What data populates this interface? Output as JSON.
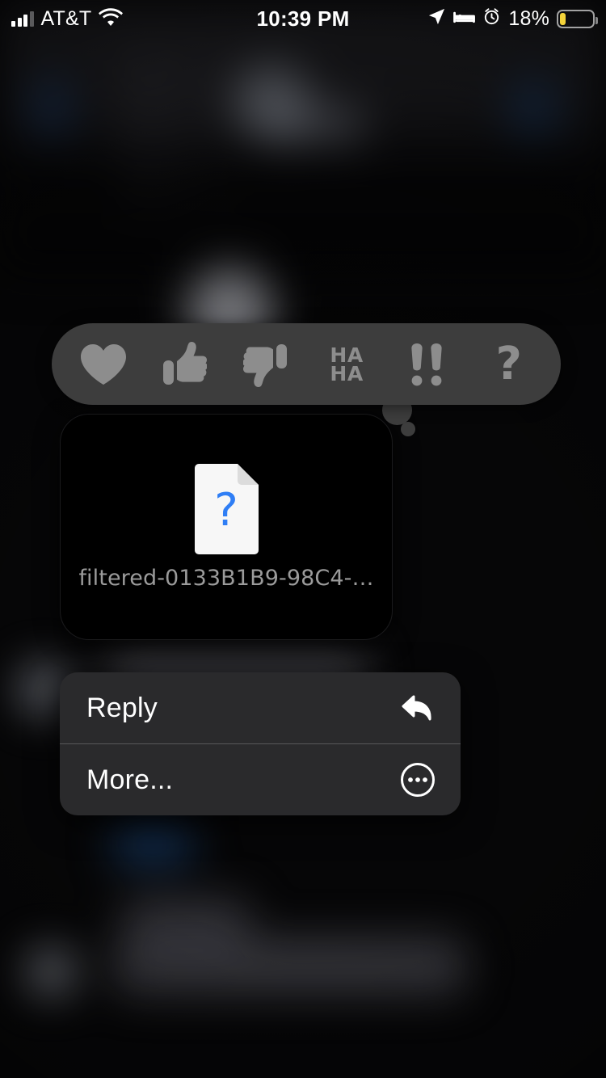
{
  "status_bar": {
    "carrier": "AT&T",
    "time": "10:39 PM",
    "battery_percent": "18%",
    "battery_level": 18,
    "battery_color": "#f4d33a",
    "signal_bars_filled": 3,
    "signal_bars_total": 4,
    "icons": [
      "signal-bars-icon",
      "wifi-icon",
      "location-arrow-icon",
      "bed-sleep-icon",
      "alarm-clock-icon",
      "battery-icon"
    ]
  },
  "tapback": {
    "reactions": [
      {
        "name": "heart",
        "label": "Love"
      },
      {
        "name": "thumbs-up",
        "label": "Like"
      },
      {
        "name": "thumbs-down",
        "label": "Dislike"
      },
      {
        "name": "haha",
        "label": "HA\nHA",
        "line1": "HA",
        "line2": "HA"
      },
      {
        "name": "exclamation",
        "label": "!!"
      },
      {
        "name": "question",
        "label": "?"
      }
    ],
    "background_color": "#3d3d3d",
    "glyph_color": "#8d8d8d"
  },
  "message": {
    "attachment_filename": "filtered-0133B1B9-98C4-…",
    "attachment_icon": "unknown-document-icon",
    "document_glyph": "?",
    "document_glyph_color": "#2f7ef5",
    "bubble_color": "#000000"
  },
  "context_menu": {
    "items": [
      {
        "label": "Reply",
        "icon": "reply-arrow-icon"
      },
      {
        "label": "More...",
        "icon": "ellipsis-circle-icon"
      }
    ],
    "background_color": "#2a2a2c"
  }
}
